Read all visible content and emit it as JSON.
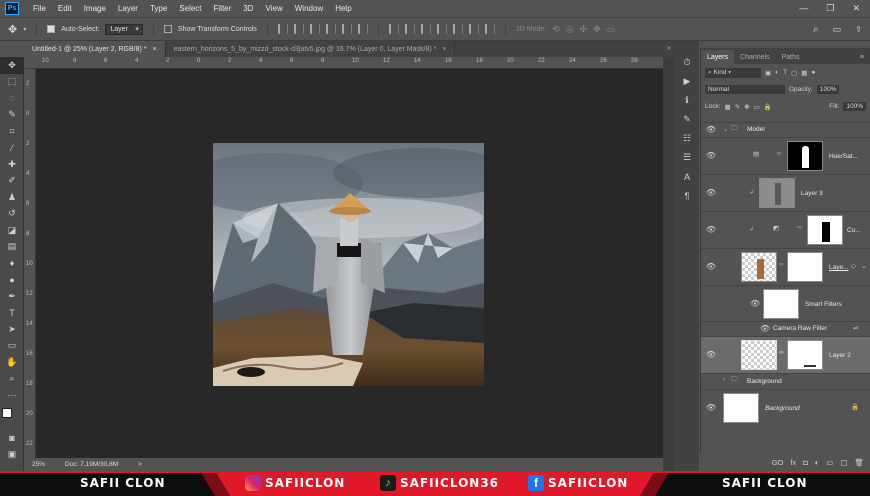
{
  "app": {
    "logo": "Ps"
  },
  "menu": [
    "File",
    "Edit",
    "Image",
    "Layer",
    "Type",
    "Select",
    "Filter",
    "3D",
    "View",
    "Window",
    "Help"
  ],
  "window_controls": [
    "—",
    "❐",
    "✕"
  ],
  "options": {
    "auto_select_label": "Auto-Select:",
    "auto_select_value": "Layer",
    "show_transform_label": "Show Transform Controls",
    "mode_3d_label": "3D Mode:"
  },
  "tabs": [
    {
      "label": "Untitled-1 @ 25% (Layer 2, RGB/8) *",
      "close": "×"
    },
    {
      "label": "eastern_horizons_5_by_mizzd_stock-d3jatv5.jpg @ 16.7% (Layer 0, Layer Mask/8) *",
      "close": "×"
    }
  ],
  "ruler_top": [
    "10",
    "8",
    "6",
    "4",
    "2",
    "0",
    "2",
    "4",
    "6",
    "8",
    "10",
    "12",
    "14",
    "16",
    "18",
    "20",
    "22",
    "24",
    "26",
    "28"
  ],
  "ruler_left": [
    "2",
    "0",
    "2",
    "4",
    "6",
    "8",
    "10",
    "12",
    "14",
    "16",
    "18",
    "20",
    "22"
  ],
  "status": {
    "zoom": "25%",
    "doc": "Doc: 7,19M/30,8M",
    "arrow": ">"
  },
  "layers_panel": {
    "tabs": [
      "Layers",
      "Channels",
      "Paths"
    ],
    "kind_label": "Kind",
    "blend_mode": "Normal",
    "opacity_label": "Opacity:",
    "opacity_value": "100%",
    "lock_label": "Lock:",
    "fill_label": "Fill:",
    "fill_value": "100%",
    "layers": [
      {
        "name": "Model"
      },
      {
        "name": "Hue/Sat..."
      },
      {
        "name": "Layer 3"
      },
      {
        "name": "Cu..."
      },
      {
        "name": "Laye..."
      },
      {
        "name": "Smart Filters"
      },
      {
        "name": "Camera Raw Filter"
      },
      {
        "name": "Layer 2"
      },
      {
        "name": "Background"
      },
      {
        "name": "Background"
      }
    ],
    "footer_icons": [
      "GO",
      "fx",
      "◘",
      "◐",
      "▭",
      "▢",
      "🗑"
    ]
  },
  "banner": {
    "left": "SAFII CLON",
    "instagram": "SAFIICLON",
    "tiktok": "SAFIICLON36",
    "facebook": "SAFIICLON",
    "right": "SAFII CLON",
    "accent": "#e0182a"
  }
}
